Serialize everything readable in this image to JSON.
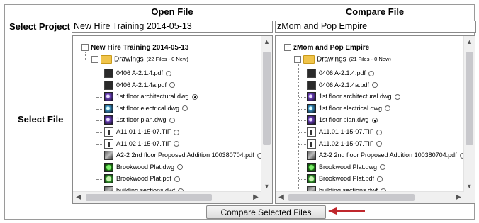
{
  "headers": {
    "open": "Open File",
    "compare": "Compare File"
  },
  "labels": {
    "select_project": "Select Project",
    "select_file": "Select File"
  },
  "projects": {
    "open": "New Hire Training 2014-05-13",
    "compare": "zMom and Pop Empire"
  },
  "open_tree": {
    "root": "New Hire Training 2014-05-13",
    "folder": "Drawings",
    "count": "(22 Files - 0 New)",
    "files": [
      {
        "name": "0406 A-2.1.4.pdf",
        "icon": "pdf-icon",
        "selected": false
      },
      {
        "name": "0406 A-2.1.4a.pdf",
        "icon": "pdf-icon",
        "selected": false
      },
      {
        "name": "1st floor architectural.dwg",
        "icon": "dwg-icon",
        "selected": true
      },
      {
        "name": "1st floor electrical.dwg",
        "icon": "dwg-icon",
        "selected": false
      },
      {
        "name": "1st floor plan.dwg",
        "icon": "dwg-icon",
        "selected": false
      },
      {
        "name": "A11.01 1-15-07.TIF",
        "icon": "tif-icon",
        "selected": false
      },
      {
        "name": "A11.02 1-15-07.TIF",
        "icon": "tif-icon",
        "selected": false
      },
      {
        "name": "A2-2 2nd floor Proposed Addition 100380704.pdf",
        "icon": "image-icon",
        "selected": false
      },
      {
        "name": "Brookwood Plat.dwg",
        "icon": "plat-dwg-icon",
        "selected": false
      },
      {
        "name": "Brookwood Plat.pdf",
        "icon": "plat-pdf-icon",
        "selected": false
      },
      {
        "name": "building sections.dwf",
        "icon": "dwf-icon",
        "selected": false
      }
    ]
  },
  "compare_tree": {
    "root": "zMom and Pop Empire",
    "folder": "Drawings",
    "count": "(21 Files - 0 New)",
    "files": [
      {
        "name": "0406 A-2.1.4.pdf",
        "icon": "pdf-icon",
        "selected": false
      },
      {
        "name": "0406 A-2.1.4a.pdf",
        "icon": "pdf-icon",
        "selected": false
      },
      {
        "name": "1st floor architectural.dwg",
        "icon": "dwg-icon",
        "selected": false
      },
      {
        "name": "1st floor electrical.dwg",
        "icon": "dwg-icon",
        "selected": false
      },
      {
        "name": "1st floor plan.dwg",
        "icon": "dwg-icon",
        "selected": true
      },
      {
        "name": "A11.01 1-15-07.TIF",
        "icon": "tif-icon",
        "selected": false
      },
      {
        "name": "A11.02 1-15-07.TIF",
        "icon": "tif-icon",
        "selected": false
      },
      {
        "name": "A2-2 2nd floor Proposed Addition 100380704.pdf",
        "icon": "image-icon",
        "selected": false
      },
      {
        "name": "Brookwood Plat.dwg",
        "icon": "plat-dwg-icon",
        "selected": false
      },
      {
        "name": "Brookwood Plat.pdf",
        "icon": "plat-pdf-icon",
        "selected": false
      },
      {
        "name": "building sections.dwf",
        "icon": "dwf-icon",
        "selected": false
      }
    ]
  },
  "compare_button": "Compare Selected Files"
}
